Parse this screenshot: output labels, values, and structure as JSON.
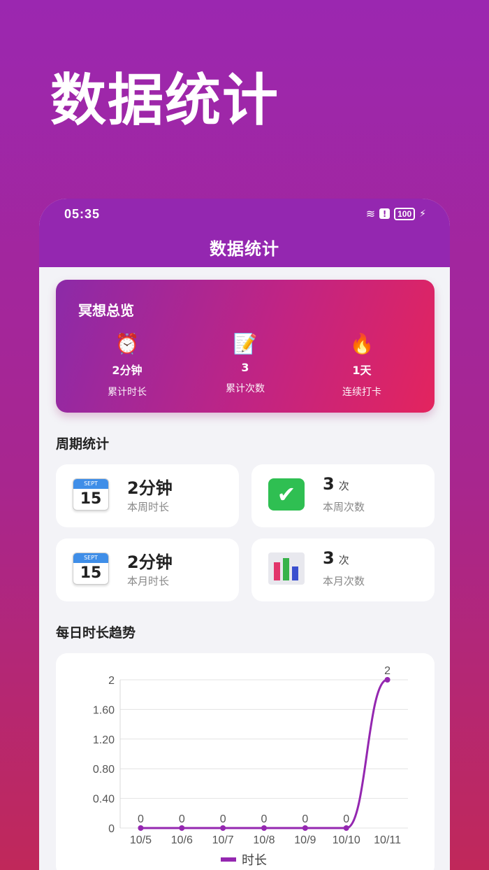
{
  "promo": {
    "title": "数据统计"
  },
  "status_bar": {
    "time": "05:35",
    "battery": "100"
  },
  "nav": {
    "title": "数据统计"
  },
  "overview": {
    "title": "冥想总览",
    "items": [
      {
        "icon": "alarm-clock-icon",
        "value": "2分钟",
        "label": "累计时长"
      },
      {
        "icon": "memo-icon",
        "value": "3",
        "label": "累计次数"
      },
      {
        "icon": "fire-icon",
        "value": "1天",
        "label": "连续打卡"
      }
    ]
  },
  "period": {
    "title": "周期统计",
    "cards": [
      {
        "icon": "calendar-icon",
        "value": "2分钟",
        "unit": "",
        "label": "本周时长"
      },
      {
        "icon": "check-icon",
        "value": "3",
        "unit": "次",
        "label": "本周次数"
      },
      {
        "icon": "calendar-icon",
        "value": "2分钟",
        "unit": "",
        "label": "本月时长"
      },
      {
        "icon": "bar-chart-icon",
        "value": "3",
        "unit": "次",
        "label": "本月次数"
      }
    ]
  },
  "trend": {
    "title": "每日时长趋势"
  },
  "calendar_icon": {
    "month": "SEPT",
    "day": "15"
  },
  "chart_data": {
    "type": "line",
    "categories": [
      "10/5",
      "10/6",
      "10/7",
      "10/8",
      "10/9",
      "10/10",
      "10/11"
    ],
    "series": [
      {
        "name": "时长",
        "values": [
          0,
          0,
          0,
          0,
          0,
          0,
          2
        ],
        "color": "#9427b0"
      }
    ],
    "y_ticks": [
      "0",
      "0.40",
      "0.80",
      "1.20",
      "1.60",
      "2"
    ],
    "ylim": [
      0,
      2
    ],
    "grid": true,
    "legend": "bottom"
  }
}
